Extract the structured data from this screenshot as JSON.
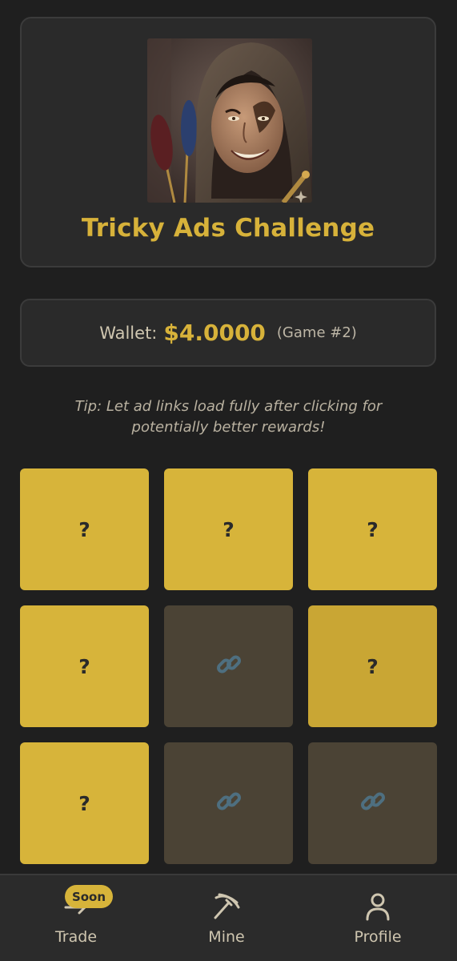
{
  "hero": {
    "title": "Tricky Ads Challenge",
    "image_alt": "hooded jester portrait"
  },
  "wallet": {
    "label": "Wallet:",
    "amount": "$4.0000",
    "game": "(Game #2)"
  },
  "tip": {
    "line1": "Tip: Let ad links load fully after clicking for",
    "line2": "potentially better rewards!"
  },
  "tiles": [
    {
      "state": "hidden",
      "label": "?"
    },
    {
      "state": "hidden",
      "label": "?"
    },
    {
      "state": "hidden",
      "label": "?"
    },
    {
      "state": "hidden",
      "label": "?"
    },
    {
      "state": "revealed",
      "icon": "link-icon"
    },
    {
      "state": "hidden",
      "label": "?"
    },
    {
      "state": "hidden",
      "label": "?"
    },
    {
      "state": "revealed",
      "icon": "link-icon"
    },
    {
      "state": "revealed",
      "icon": "link-icon"
    }
  ],
  "nav": {
    "trade": {
      "label": "Trade",
      "badge": "Soon",
      "icon": "arrow-right-icon"
    },
    "mine": {
      "label": "Mine",
      "icon": "pickaxe-icon"
    },
    "profile": {
      "label": "Profile",
      "icon": "user-icon"
    }
  },
  "colors": {
    "accent": "#d7b23a",
    "background": "#1f1f1f",
    "card": "#2a2a2a",
    "tile_revealed": "#4b4335",
    "link_icon": "#4e6f80"
  }
}
